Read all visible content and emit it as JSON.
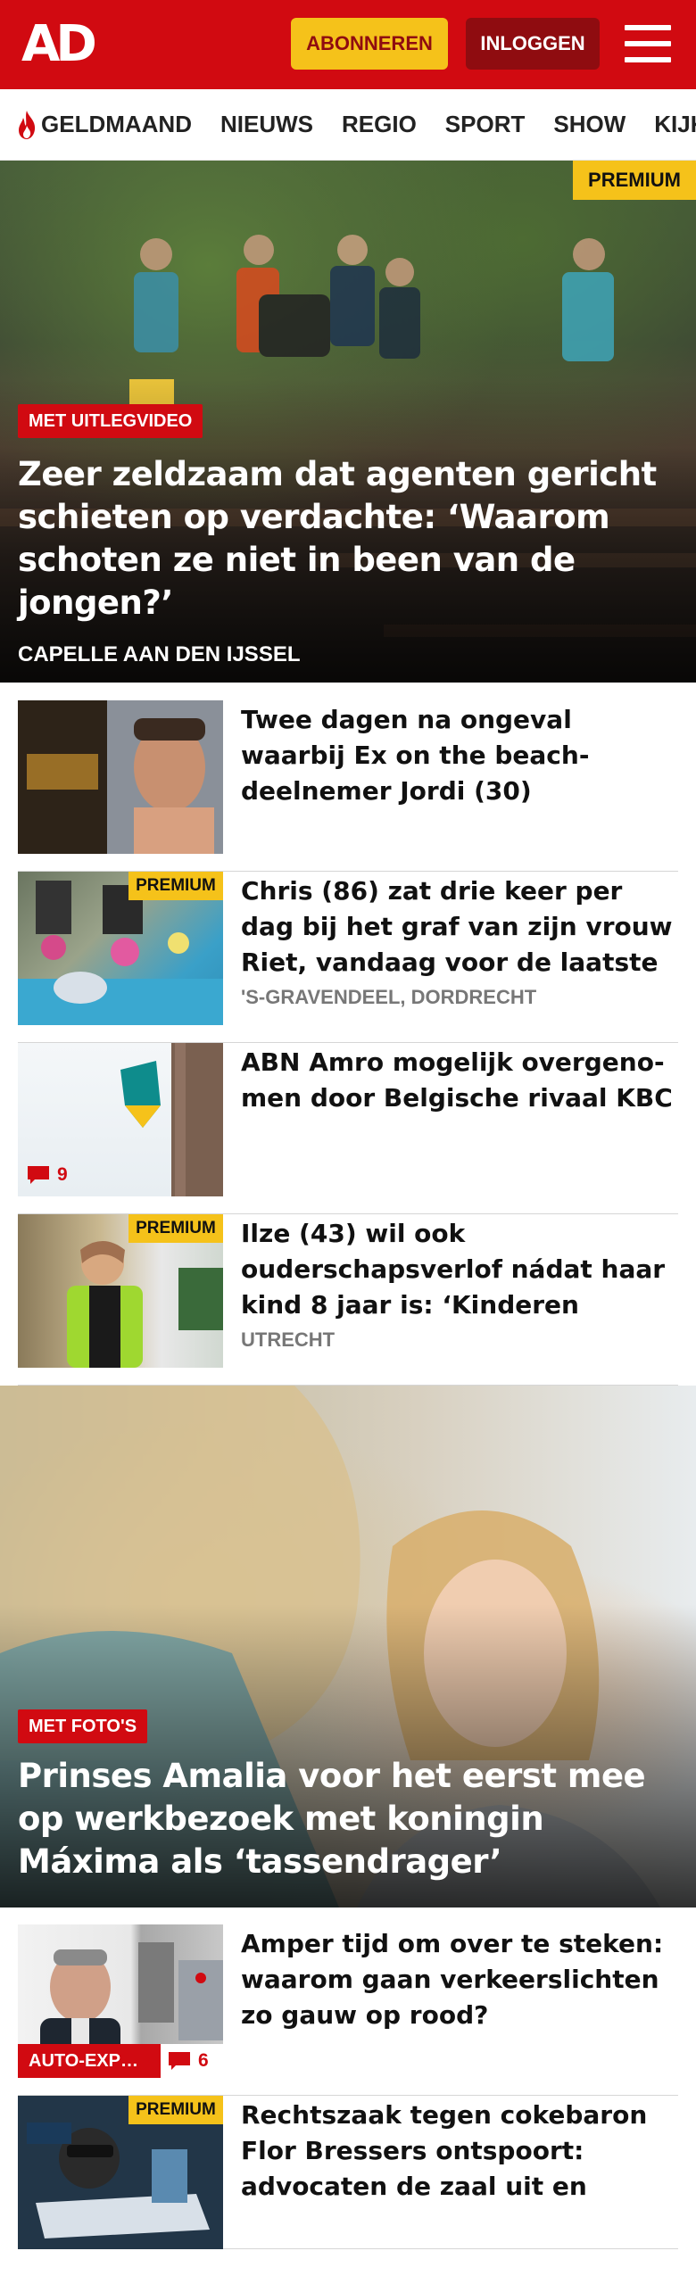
{
  "header": {
    "logo": "AD",
    "subscribe_label": "ABONNEREN",
    "login_label": "INLOGGEN",
    "menu_icon": "hamburger-menu-icon",
    "brand_red": "#d10a11",
    "accent_yellow": "#f5c21a"
  },
  "nav": {
    "items": [
      {
        "label": "GELDMAAND",
        "icon": "flame-icon"
      },
      {
        "label": "NIEUWS"
      },
      {
        "label": "REGIO"
      },
      {
        "label": "SPORT"
      },
      {
        "label": "SHOW"
      },
      {
        "label": "KIJK"
      }
    ]
  },
  "hero1": {
    "premium": "PREMIUM",
    "tag": "MET UITLEGVIDEO",
    "title": "Zeer zeldzaam dat agenten gericht schieten op verdachte: ‘Waarom schoten ze niet in been van de jongen?’",
    "location": "CAPELLE AAN DEN IJSSEL"
  },
  "articles": [
    {
      "title": "Twee dagen na ongeval waarbij Ex on the beach-deelnemer Jordi (30) omkwam, meldt bestuurder zich bij politie"
    },
    {
      "premium": "PREMIUM",
      "title": "Chris (86) zat drie keer per dag bij het graf van zijn vrouw Riet, vandaag voor de laatste keer",
      "location": "'S-GRAVENDEEL, DORDRECHT"
    },
    {
      "title": "ABN Amro mogelijk overgeno­men door Belgische rivaal KBC",
      "comments": "9"
    },
    {
      "premium": "PREMIUM",
      "title": "Ilze (43) wil ook ouderschapsver­lof nádat haar kind 8 jaar is: ‘Kinderen worstelen vaker met problemen op latere leeftijd’",
      "location": "UTRECHT"
    }
  ],
  "hero2": {
    "tag": "MET FOTO'S",
    "title": "Prinses Amalia voor het eerst mee op werkbezoek met koningin Máxima als ‘tassendrager’"
  },
  "articles2": [
    {
      "tag": "AUTO-EXP…",
      "comments": "6",
      "title": "Amper tijd om over te steken: waarom gaan verkeerslichten zo gauw op rood?"
    },
    {
      "premium": "PREMIUM",
      "title": "Rechtszaak tegen cokebaron Flor Bressers ontspoort: advocaten de zaal uit en rechters weigeren verder te gaan"
    }
  ]
}
